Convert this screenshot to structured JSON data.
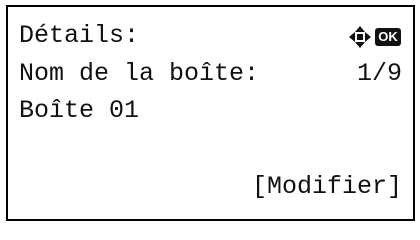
{
  "screen": {
    "title": "Détails:",
    "field_label": "Nom de la boîte:",
    "page_indicator": "1/9",
    "field_value": "Boîte 01",
    "softkey_label": "[Modifier]",
    "icons": {
      "nav": "four-way-arrow-icon",
      "ok": "OK"
    }
  }
}
